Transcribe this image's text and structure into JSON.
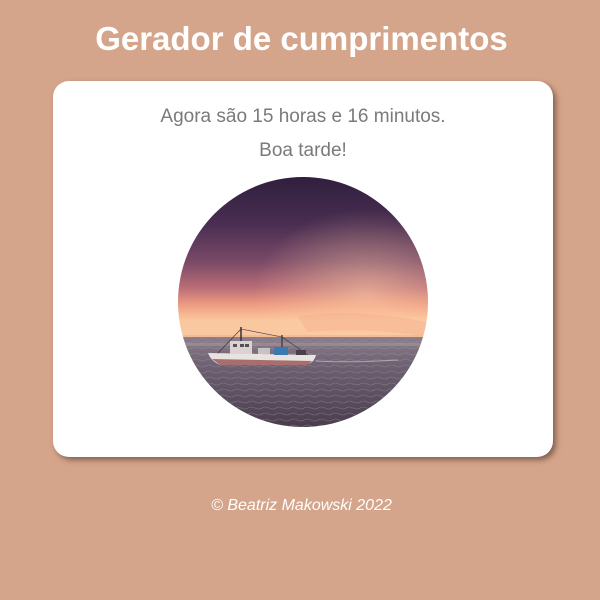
{
  "header": {
    "title": "Gerador de cumprimentos"
  },
  "main": {
    "time_message": "Agora são 15 horas e 16 minutos.",
    "greeting": "Boa tarde!",
    "image": {
      "icon": "fishing-boat-sunset-photo"
    }
  },
  "footer": {
    "credit": "© Beatriz Makowski 2022"
  },
  "colors": {
    "page_background": "#d5a58b",
    "card_background": "#ffffff",
    "title_text": "#ffffff",
    "body_text": "#7a7a7a",
    "footer_text": "#ffffff"
  }
}
